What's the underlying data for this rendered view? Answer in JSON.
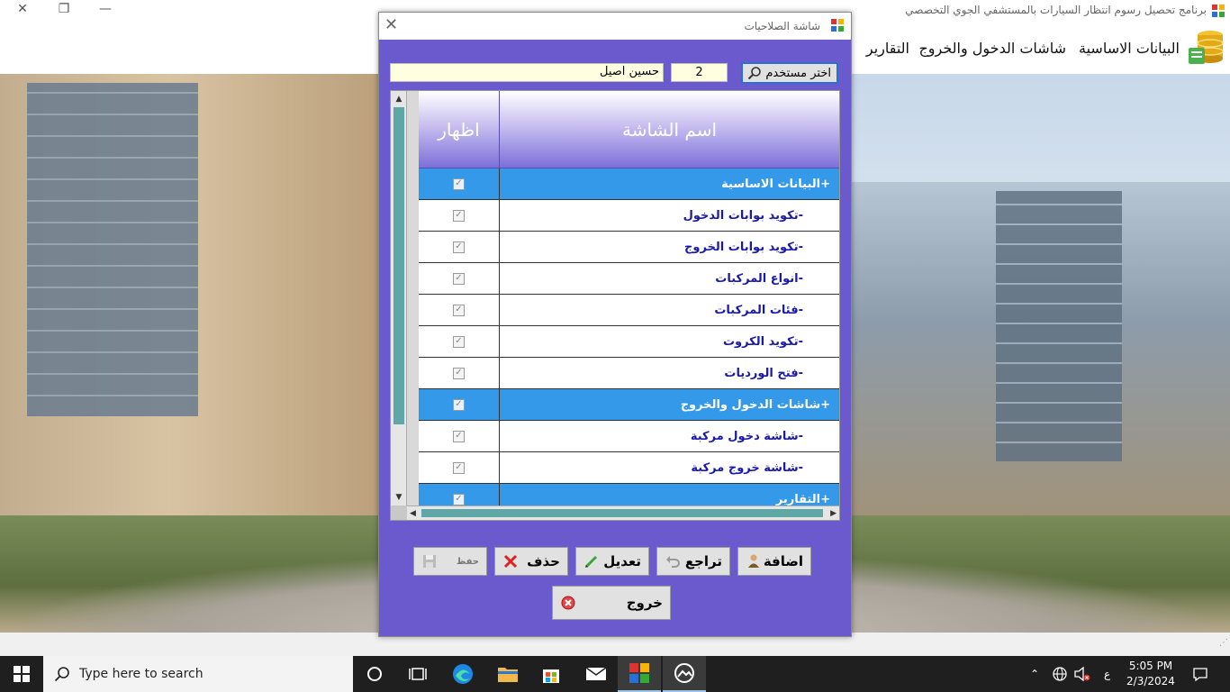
{
  "window": {
    "title": "برنامج تحصيل رسوم انتظار السيارات بالمستشفي الجوي التخصصي",
    "minimize": "—",
    "restore": "❐",
    "close": "✕"
  },
  "menu": {
    "items": [
      {
        "label": "البيانات الاساسية"
      },
      {
        "label": "شاشات الدخول والخروج"
      },
      {
        "label": "التقارير"
      }
    ]
  },
  "dialog": {
    "title": "شاشة الصلاحيات",
    "close": "✕",
    "select_user_label": "اختر مستخدم",
    "user_id": "2",
    "user_name": "حسين اصيل",
    "columns": {
      "show": "اظهار",
      "screen_name": "اسم الشاشة"
    },
    "rows": [
      {
        "name": "+البيانات الاساسية",
        "type": "group",
        "checked": true
      },
      {
        "name": "-تكويد بوابات الدخول",
        "type": "child",
        "checked": true
      },
      {
        "name": "-تكويد بوابات الخروج",
        "type": "child",
        "checked": true
      },
      {
        "name": "-انواع المركبات",
        "type": "child",
        "checked": true
      },
      {
        "name": "-فئات المركبات",
        "type": "child",
        "checked": true
      },
      {
        "name": "-تكويد الكروت",
        "type": "child",
        "checked": true
      },
      {
        "name": "-فتح الورديات",
        "type": "child",
        "checked": true
      },
      {
        "name": "+شاشات الدخول والخروج",
        "type": "group",
        "checked": true
      },
      {
        "name": "-شاشة دخول مركبة",
        "type": "child",
        "checked": true
      },
      {
        "name": "-شاشة خروج مركبة",
        "type": "child",
        "checked": true
      },
      {
        "name": "+التقارير",
        "type": "group",
        "checked": true
      }
    ],
    "buttons": {
      "add": "اضافة",
      "undo": "تراجع",
      "edit": "تعديل",
      "delete": "حذف",
      "save": "حفظ",
      "exit": "خروج"
    }
  },
  "taskbar": {
    "search_placeholder": "Type here to search",
    "time": "5:05 PM",
    "date": "2/3/2024",
    "lang": "ع"
  },
  "colors": {
    "dialog_bg": "#6a5acd",
    "group_row": "#3399e8",
    "scroll_thumb": "#5fa7a7"
  }
}
